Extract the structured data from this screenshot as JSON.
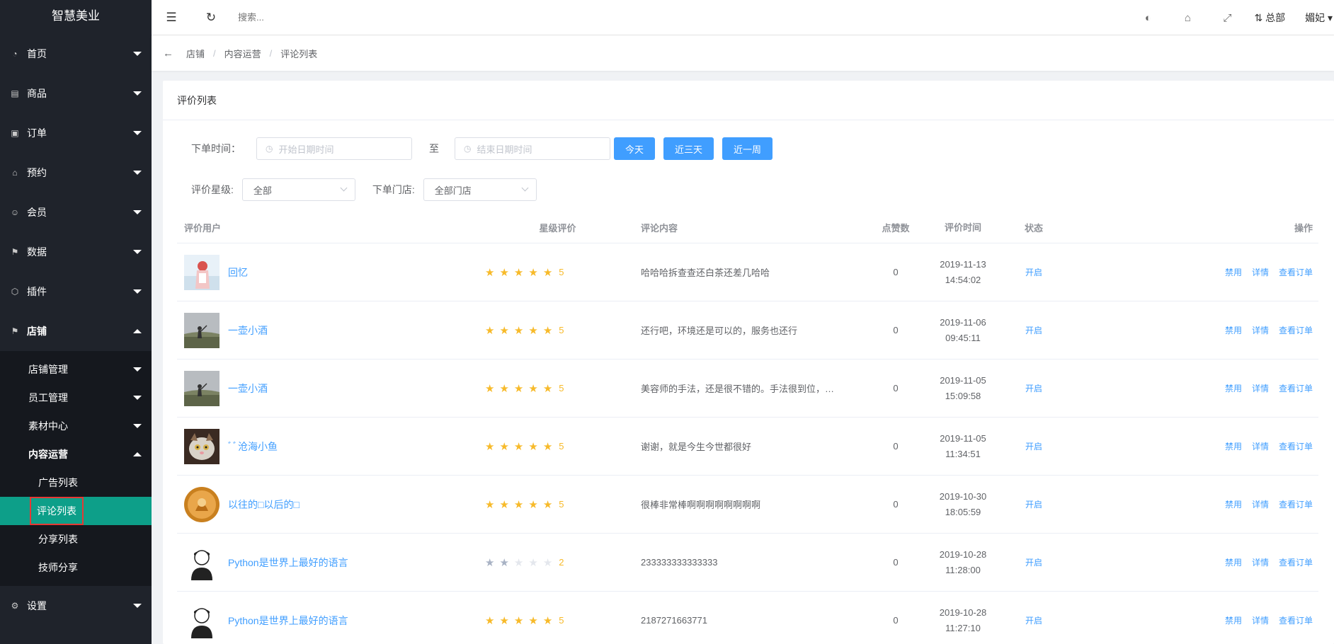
{
  "sidebar": {
    "brand": "智慧美业",
    "menu": [
      {
        "label": "首页",
        "icon": "dashboard-icon"
      },
      {
        "label": "商品",
        "icon": "goods-icon"
      },
      {
        "label": "订单",
        "icon": "order-icon"
      },
      {
        "label": "预约",
        "icon": "home-icon"
      },
      {
        "label": "会员",
        "icon": "member-icon"
      },
      {
        "label": "数据",
        "icon": "flag-icon"
      },
      {
        "label": "插件",
        "icon": "plugin-icon"
      },
      {
        "label": "店铺",
        "icon": "flag-icon"
      }
    ],
    "store_sub": [
      "店铺管理",
      "员工管理",
      "素材中心",
      "内容运营"
    ],
    "content_leaf": [
      "广告列表",
      "评论列表",
      "分享列表",
      "技师分享"
    ],
    "settings": "设置"
  },
  "topbar": {
    "search_placeholder": "搜索...",
    "hq": "总部",
    "user": "媚妃"
  },
  "breadcrumb": [
    "店铺",
    "内容运营",
    "评论列表"
  ],
  "card": {
    "title": "评价列表",
    "filters": {
      "order_time_label": "下单时间：",
      "start_placeholder": "开始日期时间",
      "to": "至",
      "end_placeholder": "结束日期时间",
      "btn_today": "今天",
      "btn_3days": "近三天",
      "btn_week": "近一周",
      "rating_label": "评价星级:",
      "rating_value": "全部",
      "store_label": "下单门店:",
      "store_value": "全部门店"
    }
  },
  "table": {
    "headers": {
      "user": "评价用户",
      "stars": "星级评价",
      "content": "评论内容",
      "likes": "点赞数",
      "time": "评价时间",
      "status": "状态",
      "ops": "操作"
    },
    "ops": {
      "disable": "禁用",
      "detail": "详情",
      "order": "查看订单"
    },
    "rows": [
      {
        "user": "回忆",
        "stars": 5,
        "score": "5",
        "content": "哈哈哈拆查查还白茶还差几哈哈",
        "likes": "0",
        "date": "2019-11-13",
        "time": "14:54:02",
        "status": "开启",
        "avatar": "girl"
      },
      {
        "user": "一壶小酒",
        "stars": 5,
        "score": "5",
        "content": "还行吧，环境还是可以的，服务也还行",
        "likes": "0",
        "date": "2019-11-06",
        "time": "09:45:11",
        "status": "开启",
        "avatar": "field"
      },
      {
        "user": "一壶小酒",
        "stars": 5,
        "score": "5",
        "content": "美容师的手法，还是很不错的。手法很到位，…",
        "likes": "0",
        "date": "2019-11-05",
        "time": "15:09:58",
        "status": "开启",
        "avatar": "field"
      },
      {
        "user": "ﾞﾞ沧海小鱼",
        "stars": 5,
        "score": "5",
        "content": "谢谢，就是今生今世都很好",
        "likes": "0",
        "date": "2019-11-05",
        "time": "11:34:51",
        "status": "开启",
        "avatar": "cat"
      },
      {
        "user": "以往的□以后的□",
        "stars": 5,
        "score": "5",
        "content": "很棒非常棒啊啊啊啊啊啊啊啊",
        "likes": "0",
        "date": "2019-10-30",
        "time": "18:05:59",
        "status": "开启",
        "avatar": "orange"
      },
      {
        "user": "Python是世界上最好的语言",
        "stars": 2,
        "score": "2",
        "content": "233333333333333",
        "likes": "0",
        "date": "2019-10-28",
        "time": "11:28:00",
        "status": "开启",
        "avatar": "boy",
        "muted": true
      },
      {
        "user": "Python是世界上最好的语言",
        "stars": 5,
        "score": "5",
        "content": "2187271663771",
        "likes": "0",
        "date": "2019-10-28",
        "time": "11:27:10",
        "status": "开启",
        "avatar": "boy"
      }
    ]
  },
  "colors": {
    "sidebar_bg": "#1f232b",
    "active_bg": "#0d9f89",
    "link": "#409eff",
    "star": "#f7ba2a"
  }
}
